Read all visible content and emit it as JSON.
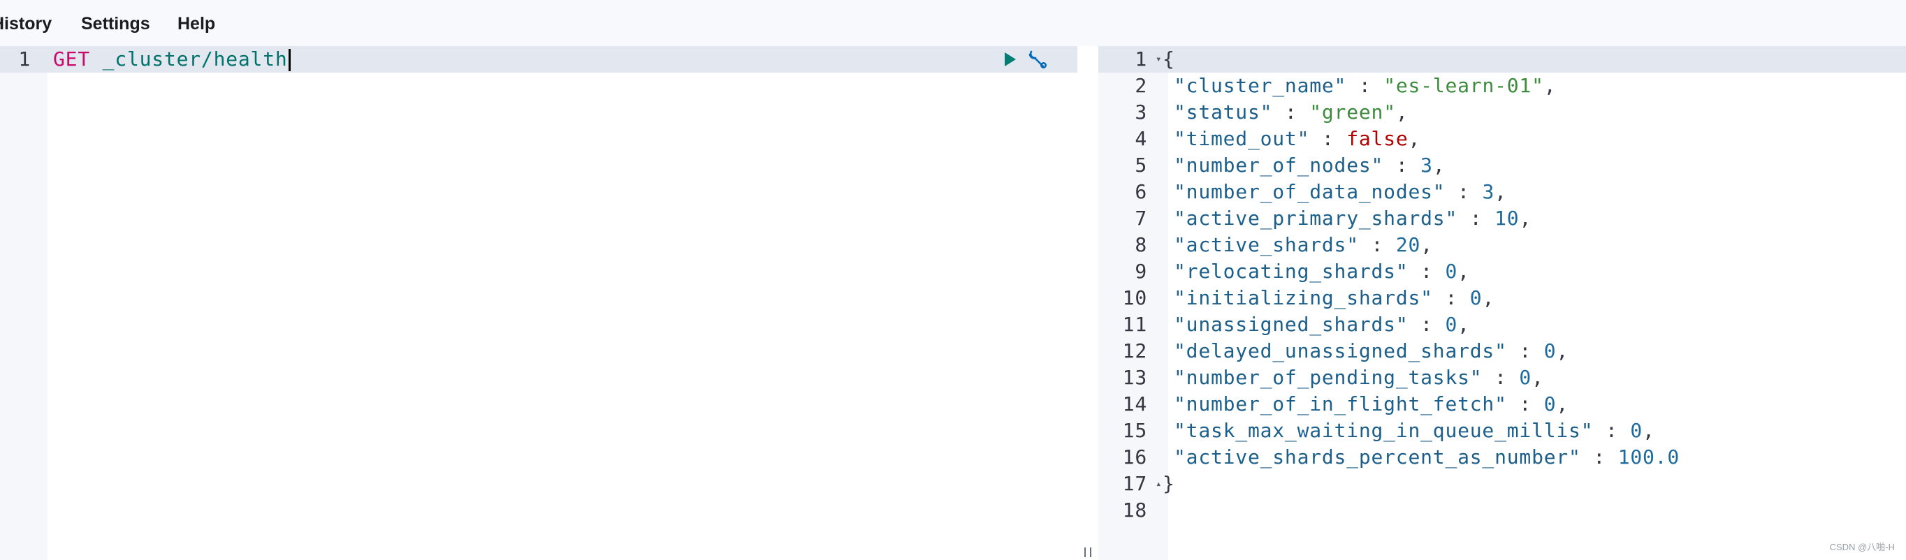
{
  "menu": {
    "history": "History",
    "settings": "Settings",
    "help": "Help"
  },
  "request_editor": {
    "lines": [
      {
        "number": "1",
        "method": "GET",
        "path": "_cluster/health"
      }
    ],
    "actions": {
      "send_icon": "play-icon",
      "settings_icon": "wrench-icon"
    }
  },
  "response_viewer": {
    "line_numbers": [
      "1",
      "2",
      "3",
      "4",
      "5",
      "6",
      "7",
      "8",
      "9",
      "10",
      "11",
      "12",
      "13",
      "14",
      "15",
      "16",
      "17",
      "18"
    ],
    "open_brace": "{",
    "close_brace": "}",
    "fields": [
      {
        "key": "\"cluster_name\"",
        "value": "\"es-learn-01\"",
        "type": "string"
      },
      {
        "key": "\"status\"",
        "value": "\"green\"",
        "type": "string"
      },
      {
        "key": "\"timed_out\"",
        "value": "false",
        "type": "boolean"
      },
      {
        "key": "\"number_of_nodes\"",
        "value": "3",
        "type": "number"
      },
      {
        "key": "\"number_of_data_nodes\"",
        "value": "3",
        "type": "number"
      },
      {
        "key": "\"active_primary_shards\"",
        "value": "10",
        "type": "number"
      },
      {
        "key": "\"active_shards\"",
        "value": "20",
        "type": "number"
      },
      {
        "key": "\"relocating_shards\"",
        "value": "0",
        "type": "number"
      },
      {
        "key": "\"initializing_shards\"",
        "value": "0",
        "type": "number"
      },
      {
        "key": "\"unassigned_shards\"",
        "value": "0",
        "type": "number"
      },
      {
        "key": "\"delayed_unassigned_shards\"",
        "value": "0",
        "type": "number"
      },
      {
        "key": "\"number_of_pending_tasks\"",
        "value": "0",
        "type": "number"
      },
      {
        "key": "\"number_of_in_flight_fetch\"",
        "value": "0",
        "type": "number"
      },
      {
        "key": "\"task_max_waiting_in_queue_millis\"",
        "value": "0",
        "type": "number"
      },
      {
        "key": "\"active_shards_percent_as_number\"",
        "value": "100.0",
        "type": "number"
      }
    ]
  },
  "watermark": "CSDN @八啪-H",
  "colors": {
    "method": "#c80a68",
    "path": "#00726b",
    "key": "#1c5f8a",
    "string": "#3d8b3d",
    "boolean": "#b30000",
    "number": "#1d6a9d",
    "play": "#017d73",
    "wrench": "#006bb8"
  }
}
